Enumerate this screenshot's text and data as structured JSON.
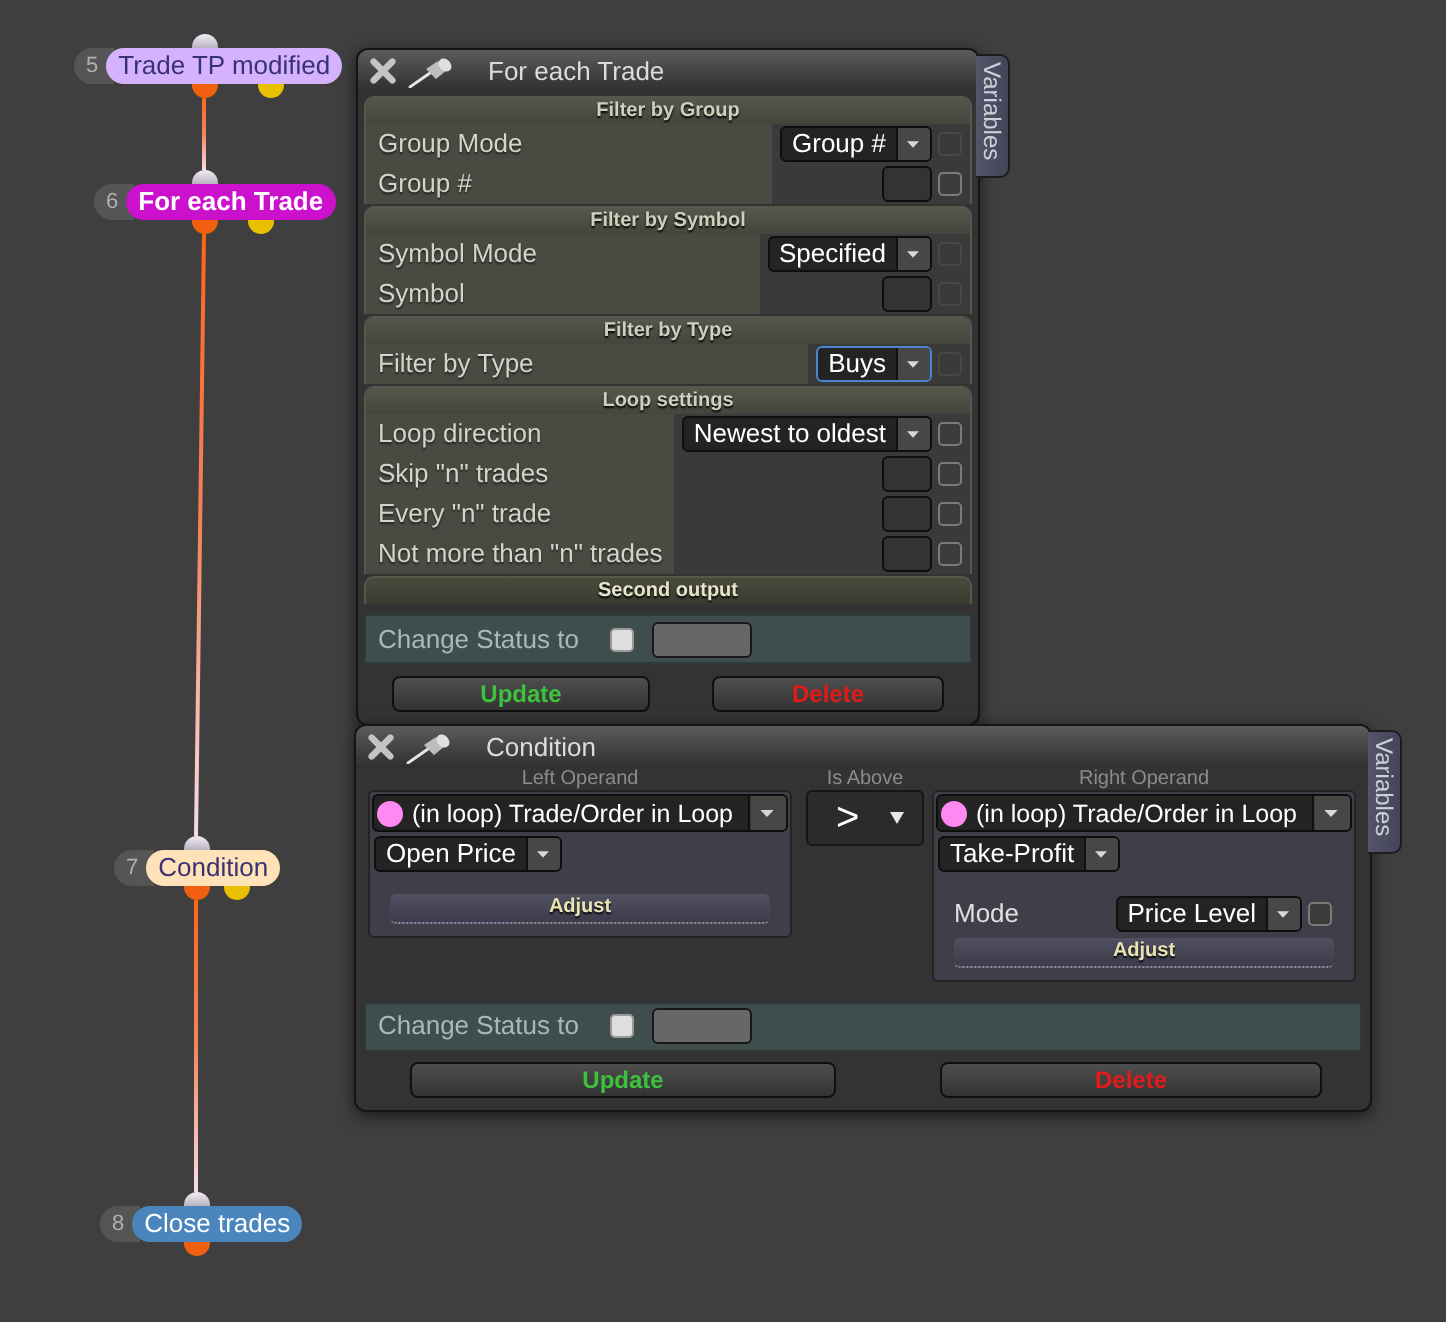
{
  "nodes": [
    {
      "number": "5",
      "label": "Trade TP modified",
      "color": "#d4b3fc",
      "selected": false,
      "secondary_output": true,
      "linked_to_next": true
    },
    {
      "number": "6",
      "label": "For each Trade",
      "color": "#cc11cc",
      "selected": true,
      "secondary_output": true,
      "linked_to_next": true
    },
    {
      "number": "7",
      "label": "Condition",
      "color": "#ffe2b8",
      "selected": false,
      "secondary_output": true,
      "linked_to_next": true
    },
    {
      "number": "8",
      "label": "Close trades",
      "color": "#4a86bd",
      "selected": false,
      "secondary_output": false,
      "linked_to_next": false
    }
  ],
  "windows": [
    {
      "kind": "filters",
      "title": "For each Trade",
      "side_tab": "Variables",
      "sections": [
        {
          "heading": "Filter by Group",
          "rows": [
            {
              "label": "Group Mode",
              "kind": "select",
              "value": "Group #",
              "focused": false,
              "checkbox": {
                "checked": false,
                "disabled": true
              }
            },
            {
              "label": "Group #",
              "kind": "input",
              "checkbox": {
                "checked": false,
                "disabled": false
              }
            }
          ]
        },
        {
          "heading": "Filter by Symbol",
          "rows": [
            {
              "label": "Symbol Mode",
              "kind": "select",
              "value": "Specified",
              "focused": false,
              "checkbox": {
                "checked": false,
                "disabled": true
              }
            },
            {
              "label": "Symbol",
              "kind": "input",
              "checkbox": {
                "checked": false,
                "disabled": true
              }
            }
          ]
        },
        {
          "heading": "Filter by Type",
          "rows": [
            {
              "label": "Filter by Type",
              "kind": "select",
              "value": "Buys",
              "focused": true,
              "checkbox": {
                "checked": false,
                "disabled": true
              }
            }
          ]
        },
        {
          "heading": "Loop settings",
          "rows": [
            {
              "label": "Loop direction",
              "kind": "select",
              "value": "Newest to oldest",
              "focused": false,
              "checkbox": {
                "checked": false,
                "disabled": false
              }
            },
            {
              "label": "Skip \"n\" trades",
              "kind": "input",
              "checkbox": {
                "checked": false,
                "disabled": false
              }
            },
            {
              "label": "Every \"n\" trade",
              "kind": "input",
              "checkbox": {
                "checked": false,
                "disabled": false
              }
            },
            {
              "label": "Not more than \"n\" trades",
              "kind": "input",
              "checkbox": {
                "checked": false,
                "disabled": false
              }
            }
          ]
        }
      ],
      "output_heading": "Second output",
      "status": {
        "label": "Change Status to",
        "checked": false
      },
      "buttons": [
        {
          "label": "Update",
          "kind": "update"
        },
        {
          "label": "Delete",
          "kind": "delete"
        }
      ]
    },
    {
      "kind": "condition",
      "title": "Condition",
      "side_tab": "Variables",
      "operands": [
        {
          "heading": "Left Operand",
          "source": "(in loop) Trade/Order in Loop",
          "field": "Open Price",
          "adjust": "Adjust"
        },
        {
          "heading": "Right Operand",
          "source": "(in loop) Trade/Order in Loop",
          "field": "Take-Profit",
          "mode": {
            "label": "Mode",
            "value": "Price Level",
            "checkbox": {
              "checked": false,
              "disabled": false
            }
          },
          "adjust": "Adjust"
        }
      ],
      "operator": {
        "heading": "Is Above",
        "symbol": ">"
      },
      "status": {
        "label": "Change Status to",
        "checked": false
      },
      "buttons": [
        {
          "label": "Update",
          "kind": "update"
        },
        {
          "label": "Delete",
          "kind": "delete"
        }
      ]
    }
  ]
}
